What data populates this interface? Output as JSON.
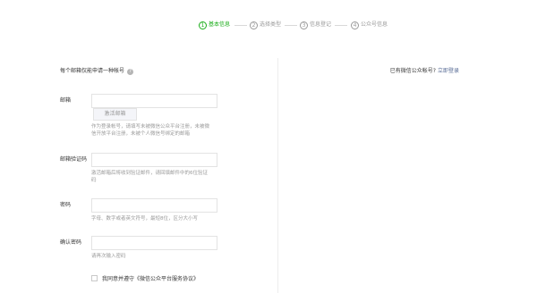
{
  "steps": [
    {
      "num": "1",
      "label": "基本信息"
    },
    {
      "num": "2",
      "label": "选择类型"
    },
    {
      "num": "3",
      "label": "信息登记"
    },
    {
      "num": "4",
      "label": "公众号信息"
    }
  ],
  "form": {
    "note": "每个邮箱仅能申请一种帐号",
    "email": {
      "label": "邮箱",
      "value": "",
      "placeholder": ""
    },
    "activate_button": "激活邮箱",
    "email_hint": "作为登录帐号，请填写未被微信公众平台注册，未被微信开放平台注册，未被个人微信号绑定的邮箱",
    "code": {
      "label": "邮箱验证码",
      "value": "",
      "placeholder": ""
    },
    "code_hint": "激活邮箱后将收到验证邮件，请回填邮件中的6位验证码",
    "password": {
      "label": "密码",
      "value": "",
      "placeholder": ""
    },
    "password_hint": "字母、数字或者英文符号，最短8位，区分大小写",
    "confirm": {
      "label": "确认密码",
      "value": "",
      "placeholder": ""
    },
    "confirm_hint": "请再次输入密码",
    "agree_text": "我同意并遵守《微信公众平台服务协议》"
  },
  "side": {
    "question": "已有微信公众帐号?",
    "login_link": "立即登录"
  },
  "colors": {
    "accent": "#1aad19",
    "link": "#576b95"
  }
}
